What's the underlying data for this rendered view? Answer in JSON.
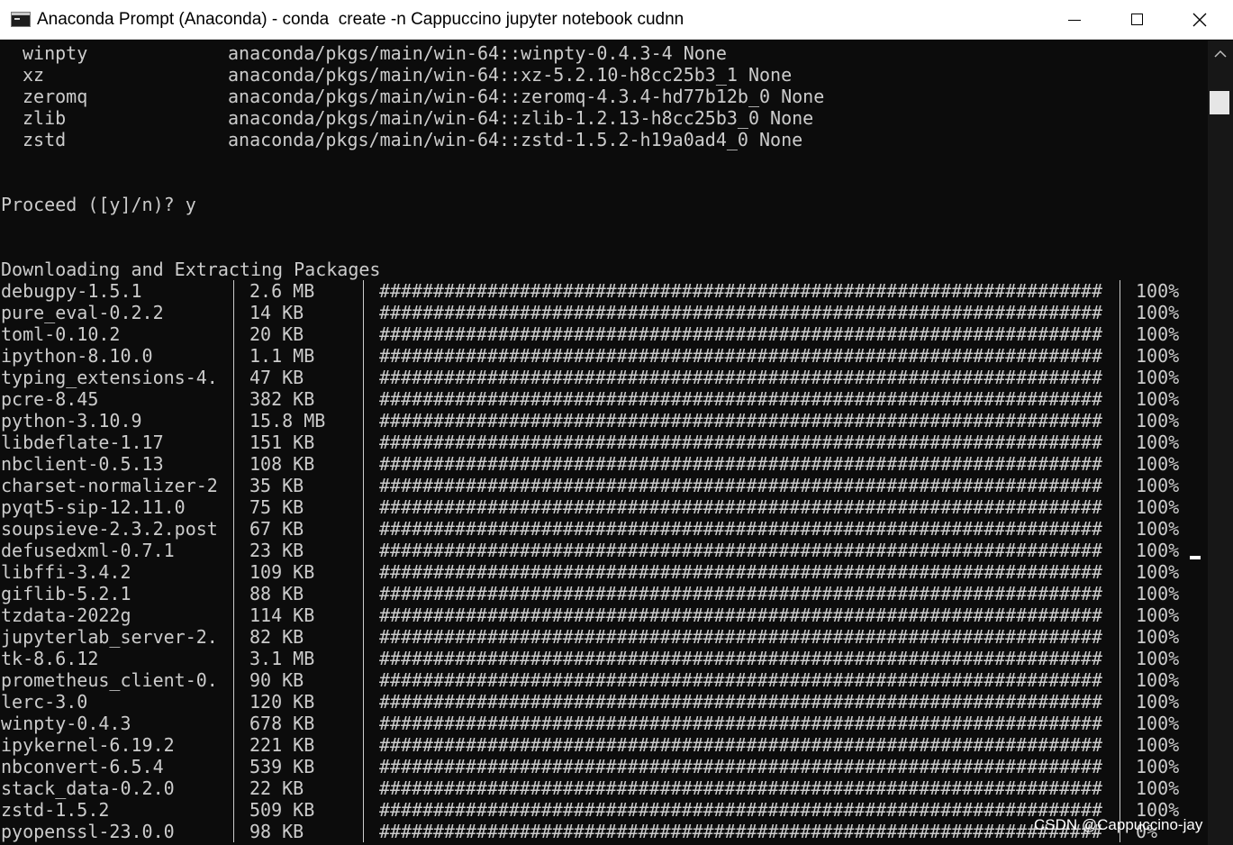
{
  "window": {
    "title": "Anaconda Prompt (Anaconda) - conda  create -n Cappuccino jupyter notebook cudnn"
  },
  "console": {
    "link_lines": [
      {
        "name": "winpty",
        "source": "anaconda/pkgs/main/win-64::winpty-0.4.3-4 None"
      },
      {
        "name": "xz",
        "source": "anaconda/pkgs/main/win-64::xz-5.2.10-h8cc25b3_1 None"
      },
      {
        "name": "zeromq",
        "source": "anaconda/pkgs/main/win-64::zeromq-4.3.4-hd77b12b_0 None"
      },
      {
        "name": "zlib",
        "source": "anaconda/pkgs/main/win-64::zlib-1.2.13-h8cc25b3_0 None"
      },
      {
        "name": "zstd",
        "source": "anaconda/pkgs/main/win-64::zstd-1.5.2-h19a0ad4_0 None"
      }
    ],
    "proceed_prompt": "Proceed ([y]/n)? y",
    "download_header": "Downloading and Extracting Packages",
    "progress_bar": "###################################################################",
    "packages": [
      {
        "name": "debugpy-1.5.1",
        "size": "2.6 MB",
        "percent": "100%"
      },
      {
        "name": "pure_eval-0.2.2",
        "size": "14 KB",
        "percent": "100%"
      },
      {
        "name": "toml-0.10.2",
        "size": "20 KB",
        "percent": "100%"
      },
      {
        "name": "ipython-8.10.0",
        "size": "1.1 MB",
        "percent": "100%"
      },
      {
        "name": "typing_extensions-4.",
        "size": "47 KB",
        "percent": "100%"
      },
      {
        "name": "pcre-8.45",
        "size": "382 KB",
        "percent": "100%"
      },
      {
        "name": "python-3.10.9",
        "size": "15.8 MB",
        "percent": "100%"
      },
      {
        "name": "libdeflate-1.17",
        "size": "151 KB",
        "percent": "100%"
      },
      {
        "name": "nbclient-0.5.13",
        "size": "108 KB",
        "percent": "100%"
      },
      {
        "name": "charset-normalizer-2",
        "size": "35 KB",
        "percent": "100%"
      },
      {
        "name": "pyqt5-sip-12.11.0",
        "size": "75 KB",
        "percent": "100%"
      },
      {
        "name": "soupsieve-2.3.2.post",
        "size": "67 KB",
        "percent": "100%"
      },
      {
        "name": "defusedxml-0.7.1",
        "size": "23 KB",
        "percent": "100%"
      },
      {
        "name": "libffi-3.4.2",
        "size": "109 KB",
        "percent": "100%"
      },
      {
        "name": "giflib-5.2.1",
        "size": "88 KB",
        "percent": "100%"
      },
      {
        "name": "tzdata-2022g",
        "size": "114 KB",
        "percent": "100%"
      },
      {
        "name": "jupyterlab_server-2.",
        "size": "82 KB",
        "percent": "100%"
      },
      {
        "name": "tk-8.6.12",
        "size": "3.1 MB",
        "percent": "100%"
      },
      {
        "name": "prometheus_client-0.",
        "size": "90 KB",
        "percent": "100%"
      },
      {
        "name": "lerc-3.0",
        "size": "120 KB",
        "percent": "100%"
      },
      {
        "name": "winpty-0.4.3",
        "size": "678 KB",
        "percent": "100%"
      },
      {
        "name": "ipykernel-6.19.2",
        "size": "221 KB",
        "percent": "100%"
      },
      {
        "name": "nbconvert-6.5.4",
        "size": "539 KB",
        "percent": "100%"
      },
      {
        "name": "stack_data-0.2.0",
        "size": "22 KB",
        "percent": "100%"
      },
      {
        "name": "zstd-1.5.2",
        "size": "509 KB",
        "percent": "100%"
      },
      {
        "name": "pyopenssl-23.0.0",
        "size": "98 KB",
        "percent": "0%"
      }
    ]
  },
  "watermark": "CSDN @Cappuccino-jay",
  "colors": {
    "console_bg": "#0c0c0c",
    "console_text": "#cccccc",
    "titlebar_bg": "#ffffff"
  }
}
